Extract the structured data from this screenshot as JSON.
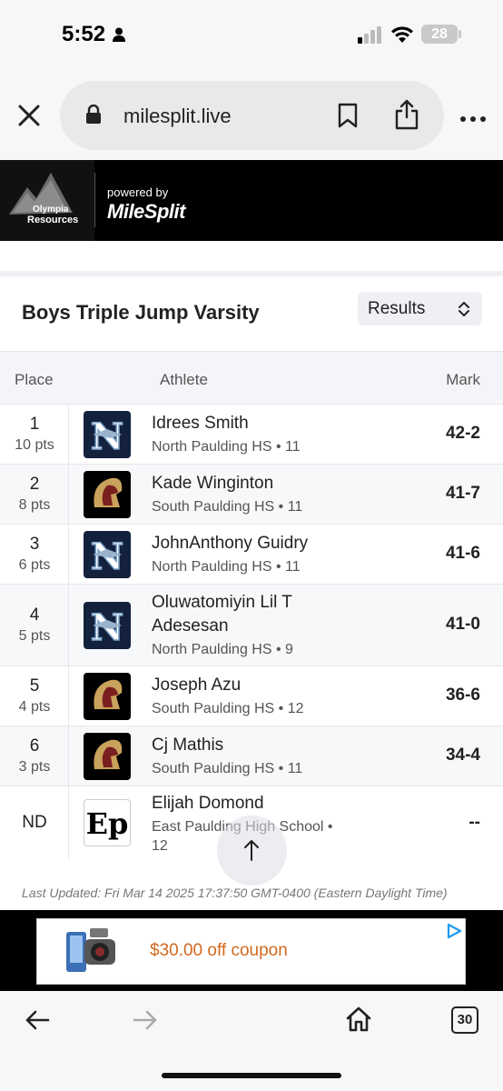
{
  "status_bar": {
    "time": "5:52",
    "battery": "28"
  },
  "browser": {
    "url": "milesplit.live",
    "tabs_count": "30"
  },
  "banner": {
    "sponsor_line1": "Olympia",
    "sponsor_line2": "Resources",
    "powered_by": "powered by",
    "brand": "MileSplit"
  },
  "event": {
    "title": "Boys Triple Jump Varsity",
    "view_select": "Results"
  },
  "table": {
    "headers": {
      "place": "Place",
      "athlete": "Athlete",
      "mark": "Mark"
    },
    "rows": [
      {
        "place": "1",
        "points": "10 pts",
        "name": "Idrees Smith",
        "school": "North Paulding HS • 11",
        "mark": "42-2",
        "logo": "north-paulding-logo"
      },
      {
        "place": "2",
        "points": "8 pts",
        "name": "Kade Winginton",
        "school": "South Paulding HS • 11",
        "mark": "41-7",
        "logo": "south-paulding-logo"
      },
      {
        "place": "3",
        "points": "6 pts",
        "name": "JohnAnthony Guidry",
        "school": "North Paulding HS • 11",
        "mark": "41-6",
        "logo": "north-paulding-logo"
      },
      {
        "place": "4",
        "points": "5 pts",
        "name_line1": "Oluwatomiyin Lil T",
        "name_line2": "Adesesan",
        "school": "North Paulding HS • 9",
        "mark": "41-0",
        "logo": "north-paulding-logo"
      },
      {
        "place": "5",
        "points": "4 pts",
        "name": "Joseph Azu",
        "school": "South Paulding HS • 12",
        "mark": "36-6",
        "logo": "south-paulding-logo"
      },
      {
        "place": "6",
        "points": "3 pts",
        "name": "Cj Mathis",
        "school": "South Paulding HS • 11",
        "mark": "34-4",
        "logo": "south-paulding-logo"
      },
      {
        "place": "ND",
        "points": "",
        "name": "Elijah Domond",
        "school_line1": "East Paulding High School •",
        "school_line2": "12",
        "mark": "--",
        "logo": "east-paulding-logo"
      }
    ]
  },
  "footer": {
    "last_updated": "Last Updated: Fri Mar 14 2025 17:37:50 GMT-0400 (Eastern Daylight Time)"
  },
  "ad": {
    "text": "$30.00 off coupon"
  },
  "colors": {
    "north_paulding_navy": "#13213d",
    "south_paulding_gold": "#c9a25b",
    "ad_text_orange": "#d2691e",
    "ad_play_blue": "#1e9bf0"
  }
}
